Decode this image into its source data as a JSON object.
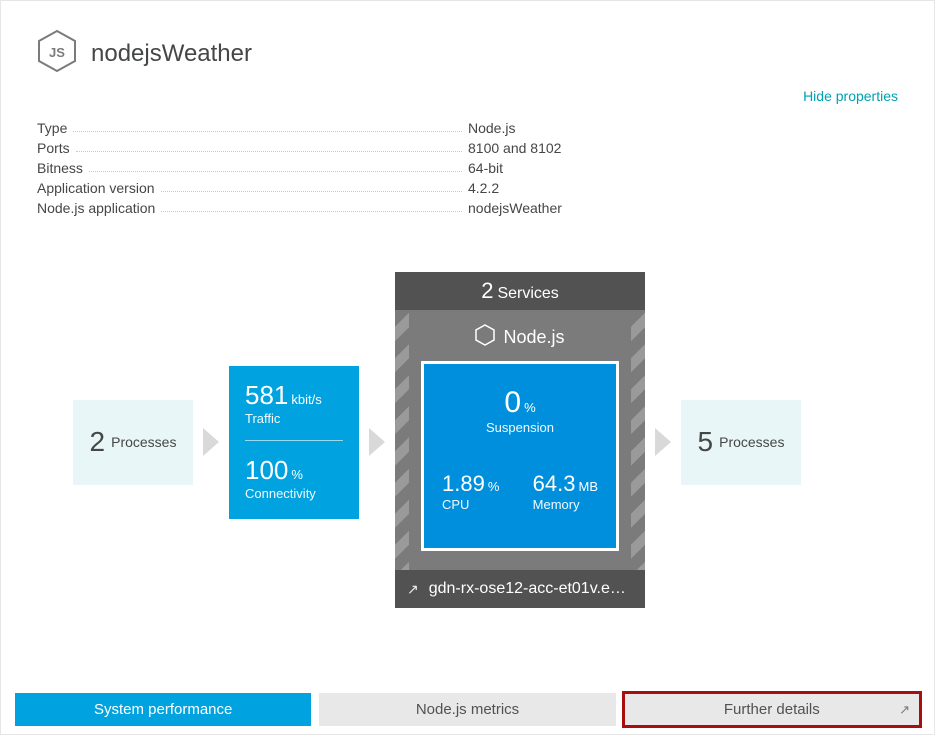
{
  "header": {
    "title": "nodejsWeather"
  },
  "hide_properties_label": "Hide properties",
  "properties": [
    {
      "label": "Type",
      "value": "Node.js"
    },
    {
      "label": "Ports",
      "value": "8100 and 8102"
    },
    {
      "label": "Bitness",
      "value": "64-bit"
    },
    {
      "label": "Application version",
      "value": "4.2.2"
    },
    {
      "label": "Node.js application",
      "value": "nodejsWeather"
    }
  ],
  "flow": {
    "left_processes": {
      "count": "2",
      "label": "Processes"
    },
    "traffic": {
      "value": "581",
      "unit": "kbit/s",
      "label": "Traffic"
    },
    "connectivity": {
      "value": "100",
      "unit": "%",
      "label": "Connectivity"
    },
    "services": {
      "count": "2",
      "label": "Services"
    },
    "node_title": "Node.js",
    "suspension": {
      "value": "0",
      "unit": "%",
      "label": "Suspension"
    },
    "cpu": {
      "value": "1.89",
      "unit": "%",
      "label": "CPU"
    },
    "memory": {
      "value": "64.3",
      "unit": "MB",
      "label": "Memory"
    },
    "host": "gdn-rx-ose12-acc-et01v.e…",
    "right_processes": {
      "count": "5",
      "label": "Processes"
    }
  },
  "tabs": {
    "system_performance": "System performance",
    "nodejs_metrics": "Node.js metrics",
    "further_details": "Further details"
  }
}
